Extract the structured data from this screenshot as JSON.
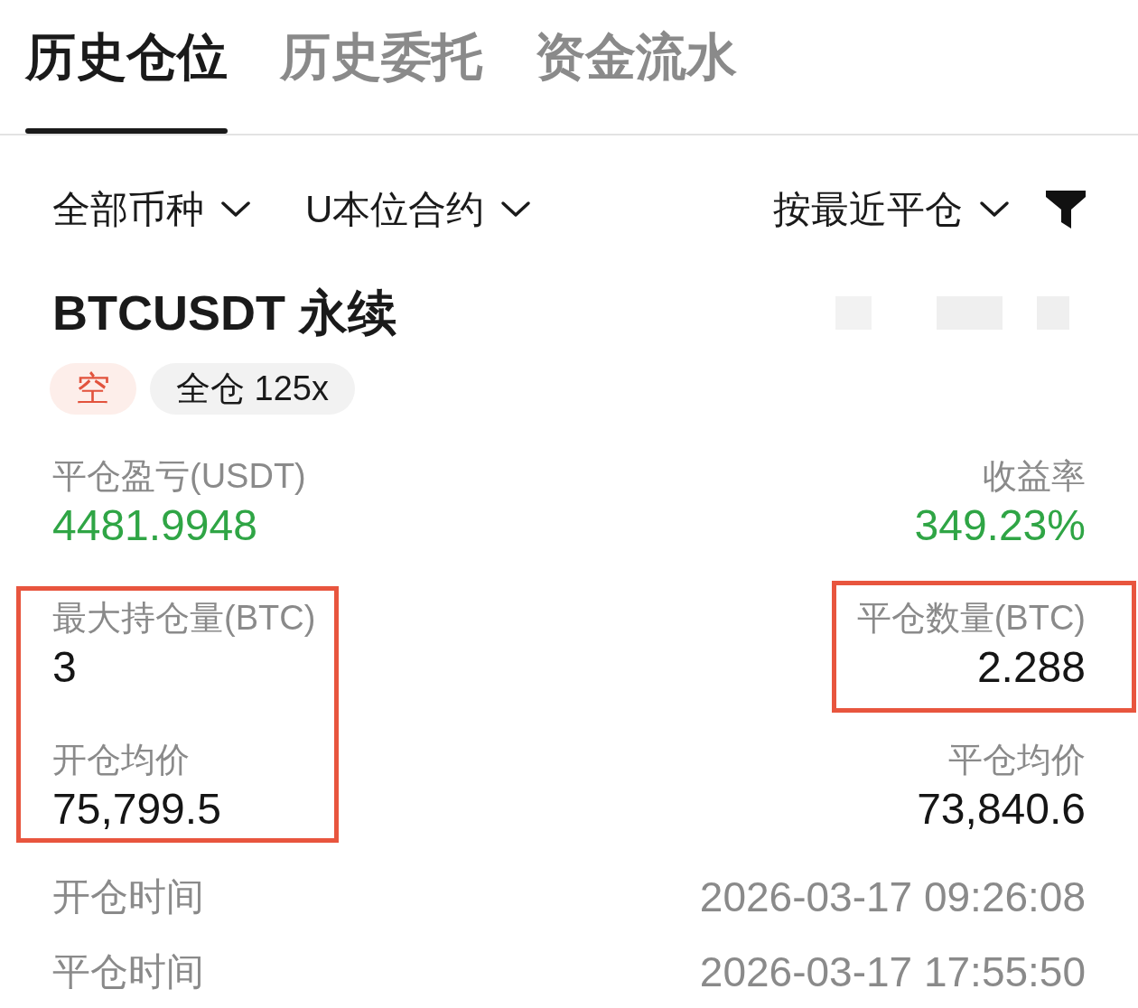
{
  "tabs": [
    {
      "label": "历史仓位",
      "selected": true
    },
    {
      "label": "历史委托",
      "selected": false
    },
    {
      "label": "资金流水",
      "selected": false
    }
  ],
  "filters": [
    {
      "label": "全部币种"
    },
    {
      "label": "U本位合约"
    }
  ],
  "sort": {
    "label": "按最近平仓"
  },
  "position": {
    "symbol": "BTCUSDT 永续",
    "tags": [
      {
        "kind": "side",
        "label": "空"
      },
      {
        "kind": "margin",
        "label": "全仓 125x"
      }
    ]
  },
  "metrics": {
    "left": [
      {
        "highlighted": false,
        "items": [
          {
            "label": "平仓盈亏(USDT)",
            "value": "4481.9948",
            "positive": true
          }
        ]
      },
      {
        "highlighted": true,
        "items": [
          {
            "label": "最大持仓量(BTC)",
            "value": "3",
            "positive": false
          },
          {
            "label": "开仓均价",
            "value": "75,799.5",
            "positive": false
          }
        ]
      }
    ],
    "right": [
      {
        "highlighted": false,
        "items": [
          {
            "label": "收益率",
            "value": "349.23%",
            "positive": true
          }
        ]
      },
      {
        "highlighted": true,
        "items": [
          {
            "label": "平仓数量(BTC)",
            "value": "2.288",
            "positive": false
          }
        ]
      },
      {
        "highlighted": false,
        "items": [
          {
            "label": "平仓均价",
            "value": "73,840.6",
            "positive": false
          }
        ]
      }
    ]
  },
  "times": [
    {
      "label": "开仓时间",
      "value": "2026-03-17 09:26:08"
    },
    {
      "label": "平仓时间",
      "value": "2026-03-17 17:55:50"
    }
  ]
}
